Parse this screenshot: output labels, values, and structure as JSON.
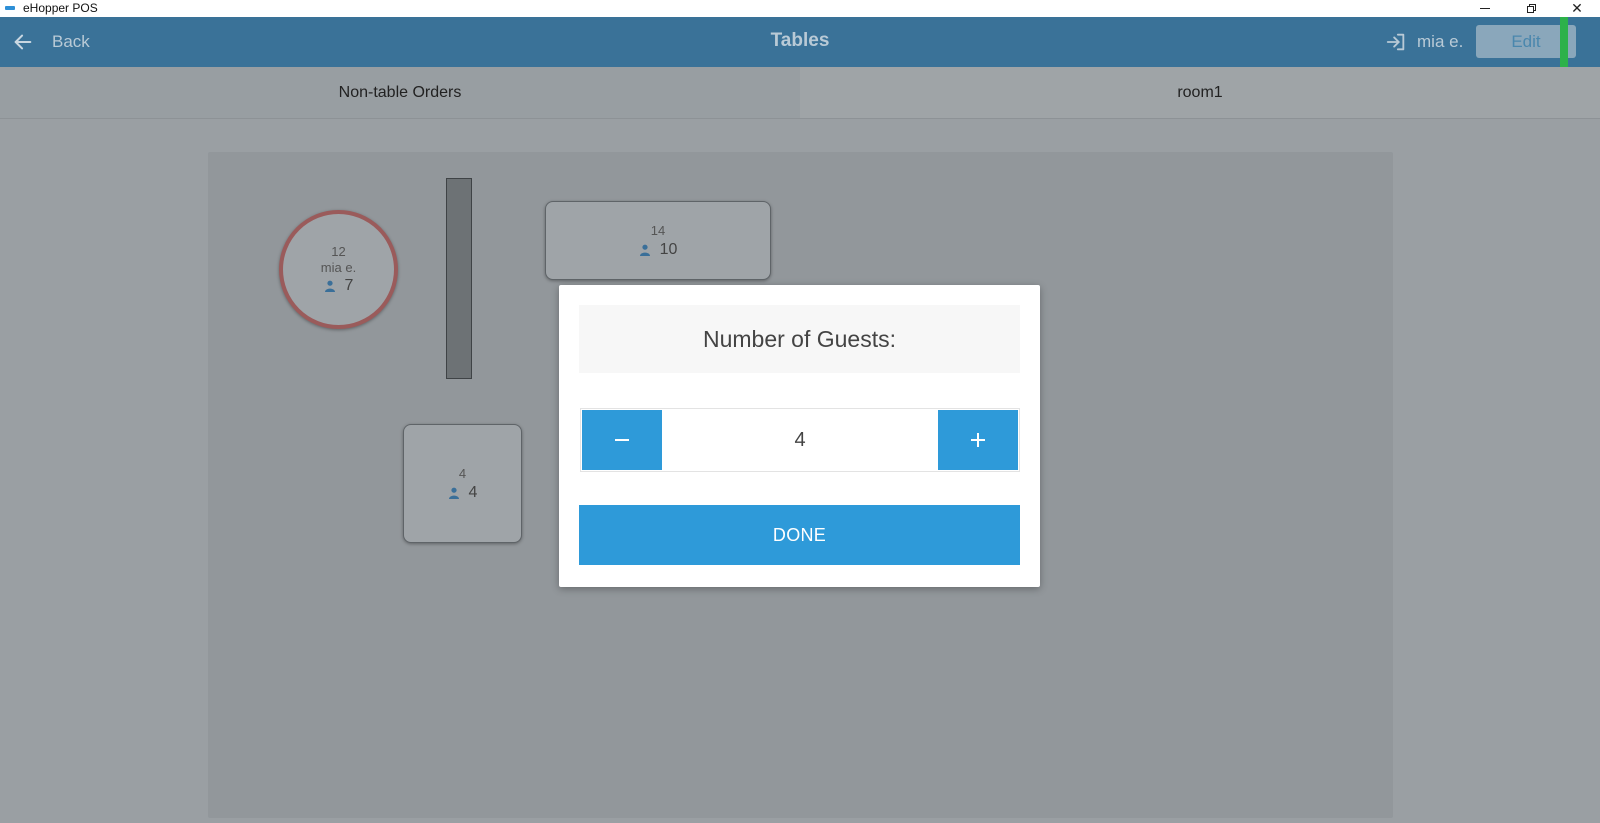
{
  "window": {
    "title": "eHopper POS"
  },
  "header": {
    "back_label": "Back",
    "title": "Tables",
    "user_name": "mia e.",
    "edit_label": "Edit"
  },
  "tabs": [
    {
      "label": "Non-table Orders",
      "active": true
    },
    {
      "label": "room1",
      "active": false
    }
  ],
  "tables": [
    {
      "number": "12",
      "server": "mia e.",
      "guests": "7",
      "shape": "round",
      "status": "occupied"
    },
    {
      "number": "14",
      "guests": "10",
      "shape": "rectangle"
    },
    {
      "number": "4",
      "guests": "4",
      "shape": "square"
    }
  ],
  "dialog": {
    "title": "Number of Guests:",
    "value": "4",
    "done_label": "DONE"
  },
  "colors": {
    "header": "#3a7298",
    "primary_button": "#2e9ad9",
    "occupied_ring": "#9a5b5b",
    "status_accent": "#2db14a"
  },
  "icons": {
    "back": "arrow-left-icon",
    "logout": "sign-out-icon",
    "guest": "person-icon",
    "decrement": "minus-icon",
    "increment": "plus-icon"
  }
}
